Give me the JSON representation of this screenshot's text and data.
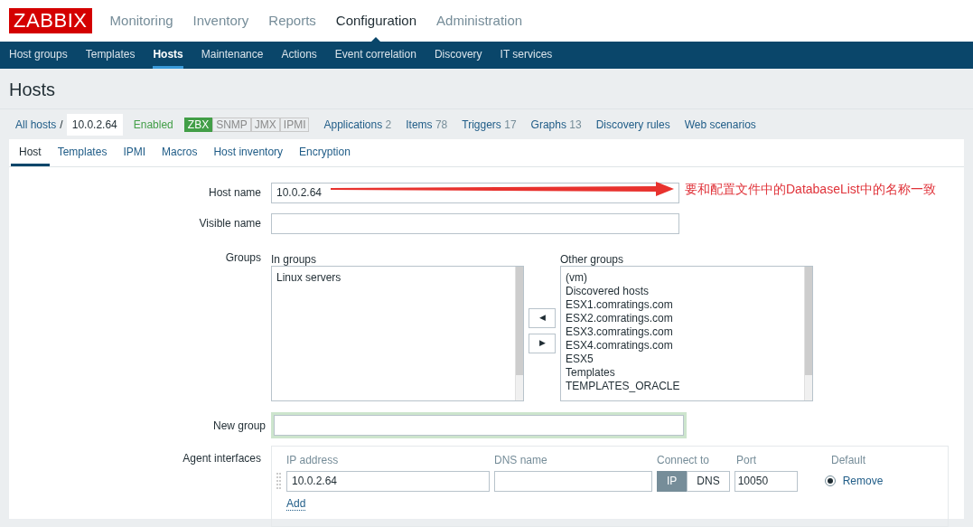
{
  "logo": "ZABBIX",
  "top_menu": [
    {
      "label": "Monitoring",
      "selected": false
    },
    {
      "label": "Inventory",
      "selected": false
    },
    {
      "label": "Reports",
      "selected": false
    },
    {
      "label": "Configuration",
      "selected": true
    },
    {
      "label": "Administration",
      "selected": false
    }
  ],
  "sub_menu": [
    {
      "label": "Host groups",
      "selected": false
    },
    {
      "label": "Templates",
      "selected": false
    },
    {
      "label": "Hosts",
      "selected": true
    },
    {
      "label": "Maintenance",
      "selected": false
    },
    {
      "label": "Actions",
      "selected": false
    },
    {
      "label": "Event correlation",
      "selected": false
    },
    {
      "label": "Discovery",
      "selected": false
    },
    {
      "label": "IT services",
      "selected": false
    }
  ],
  "page_title": "Hosts",
  "breadcrumb": {
    "parent": "All hosts",
    "separator": "/",
    "current": "10.0.2.64"
  },
  "status": "Enabled",
  "availability": [
    {
      "label": "ZBX",
      "on": true
    },
    {
      "label": "SNMP",
      "on": false
    },
    {
      "label": "JMX",
      "on": false
    },
    {
      "label": "IPMI",
      "on": false
    }
  ],
  "links": [
    {
      "label": "Applications",
      "count": "2"
    },
    {
      "label": "Items",
      "count": "78"
    },
    {
      "label": "Triggers",
      "count": "17"
    },
    {
      "label": "Graphs",
      "count": "13"
    },
    {
      "label": "Discovery rules"
    },
    {
      "label": "Web scenarios"
    }
  ],
  "tabs": [
    {
      "label": "Host",
      "selected": true
    },
    {
      "label": "Templates",
      "selected": false
    },
    {
      "label": "IPMI",
      "selected": false
    },
    {
      "label": "Macros",
      "selected": false
    },
    {
      "label": "Host inventory",
      "selected": false
    },
    {
      "label": "Encryption",
      "selected": false
    }
  ],
  "form": {
    "host_name": {
      "label": "Host name",
      "value": "10.0.2.64"
    },
    "visible_name": {
      "label": "Visible name"
    },
    "groups": {
      "label": "Groups",
      "in_label": "In groups",
      "in_groups": [
        "Linux servers"
      ],
      "other_label": "Other groups",
      "other_groups": [
        "(vm)",
        "Discovered hosts",
        "ESX1.comratings.com",
        "ESX2.comratings.com",
        "ESX3.comratings.com",
        "ESX4.comratings.com",
        "ESX5",
        "Templates",
        "TEMPLATES_ORACLE"
      ],
      "add_button": "◀",
      "remove_button": "▶"
    },
    "new_group": {
      "label": "New group"
    },
    "agent_interfaces": {
      "label": "Agent interfaces",
      "columns": [
        "IP address",
        "DNS name",
        "Connect to",
        "Port",
        "Default"
      ],
      "rows": [
        {
          "ip": "10.0.2.64",
          "dns": "",
          "connect": [
            {
              "label": "IP",
              "selected": true
            },
            {
              "label": "DNS",
              "selected": false
            }
          ],
          "port": "10050",
          "default": true,
          "remove": "Remove"
        }
      ],
      "add": "Add"
    }
  },
  "annotation": "要和配置文件中的DatabaseList中的名称一致"
}
